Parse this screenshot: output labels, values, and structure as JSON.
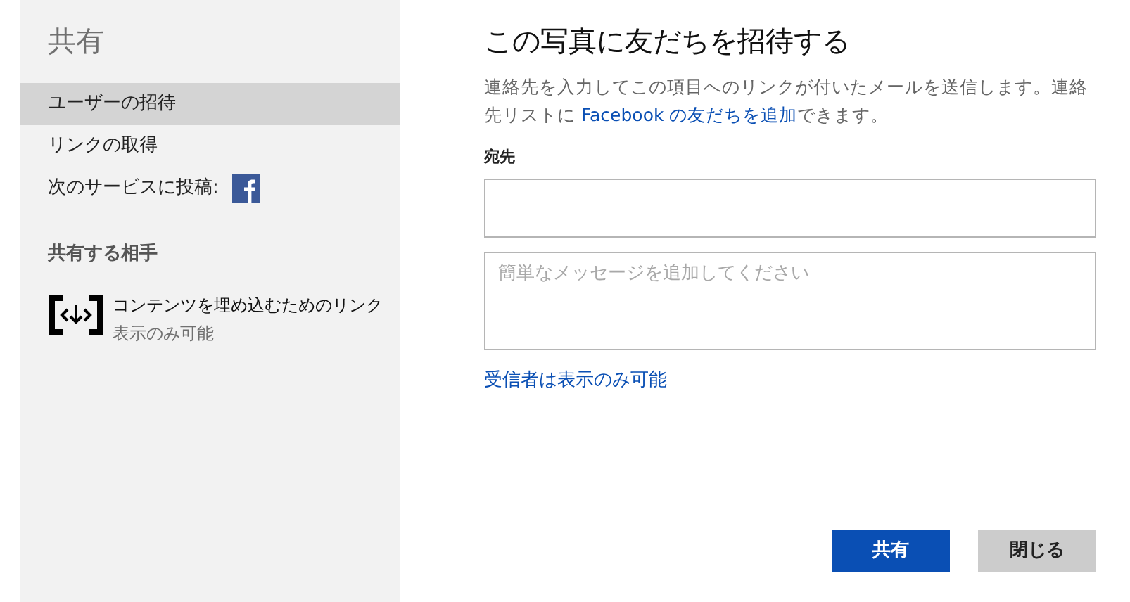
{
  "sidebar": {
    "title": "共有",
    "items": [
      {
        "label": "ユーザーの招待",
        "selected": true
      },
      {
        "label": "リンクの取得",
        "selected": false
      },
      {
        "label": "次のサービスに投稿:",
        "selected": false,
        "kind": "social"
      }
    ],
    "section_title": "共有する相手",
    "shared_with": [
      {
        "name": "コンテンツを埋め込むためのリンク",
        "permission": "表示のみ可能"
      }
    ]
  },
  "main": {
    "title": "この写真に友だちを招待する",
    "description": {
      "before": "連絡先を入力してこの項目へのリンクが付いたメールを送信します。連絡先リストに ",
      "link": "Facebook の友だちを追加",
      "after": "できます。"
    },
    "to_label": "宛先",
    "message_placeholder": "簡単なメッセージを追加してください",
    "permission_link": "受信者は表示のみ可能",
    "buttons": [
      {
        "label": "共有",
        "kind": "primary"
      },
      {
        "label": "閉じる",
        "kind": "secondary"
      }
    ]
  }
}
